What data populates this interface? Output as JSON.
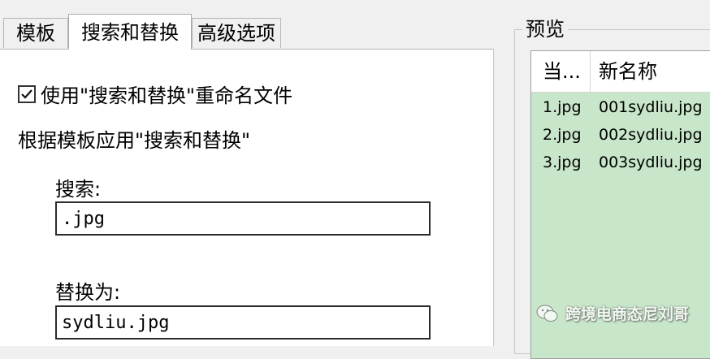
{
  "tabs": [
    {
      "label": "模板"
    },
    {
      "label": "搜索和替换"
    },
    {
      "label": "高级选项"
    }
  ],
  "active_tab": 1,
  "options": {
    "use_search_replace_label": "使用\"搜索和替换\"重命名文件",
    "use_search_replace_checked": true,
    "description": "根据模板应用\"搜索和替换\""
  },
  "search": {
    "label": "搜索:",
    "value": ".jpg"
  },
  "replace": {
    "label": "替换为:",
    "value": "sydliu.jpg"
  },
  "preview": {
    "title": "预览",
    "columns": [
      "当...",
      "新名称"
    ],
    "rows": [
      {
        "current": "1.jpg",
        "new": "001sydliu.jpg"
      },
      {
        "current": "2.jpg",
        "new": "002sydliu.jpg"
      },
      {
        "current": "3.jpg",
        "new": "003sydliu.jpg"
      }
    ],
    "background_color": "#c8e6c9"
  },
  "watermark": {
    "text": "跨境电商态尼刘哥",
    "icon": "wechat-icon"
  }
}
